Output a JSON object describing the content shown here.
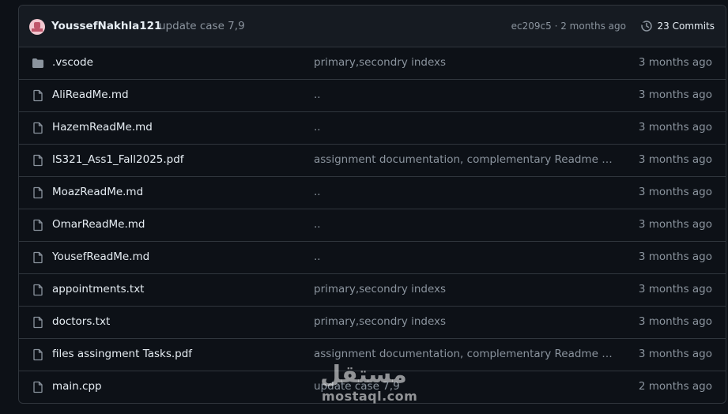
{
  "commit": {
    "author": "YoussefNakhla121",
    "message": "update case 7,9",
    "meta": "ec209c5 · 2 months ago",
    "commits_label": "23 Commits"
  },
  "files": [
    {
      "type": "folder",
      "name": ".vscode",
      "message": "primary,secondry indexs",
      "time": "3 months ago"
    },
    {
      "type": "file",
      "name": "AliReadMe.md",
      "message": "..",
      "time": "3 months ago"
    },
    {
      "type": "file",
      "name": "HazemReadMe.md",
      "message": "..",
      "time": "3 months ago"
    },
    {
      "type": "file",
      "name": "IS321_Ass1_Fall2025.pdf",
      "message": "assignment documentation, complementary Readme fil…",
      "time": "3 months ago"
    },
    {
      "type": "file",
      "name": "MoazReadMe.md",
      "message": "..",
      "time": "3 months ago"
    },
    {
      "type": "file",
      "name": "OmarReadMe.md",
      "message": "..",
      "time": "3 months ago"
    },
    {
      "type": "file",
      "name": "YousefReadMe.md",
      "message": "..",
      "time": "3 months ago"
    },
    {
      "type": "file",
      "name": "appointments.txt",
      "message": "primary,secondry indexs",
      "time": "3 months ago"
    },
    {
      "type": "file",
      "name": "doctors.txt",
      "message": "primary,secondry indexs",
      "time": "3 months ago"
    },
    {
      "type": "file",
      "name": "files assingment Tasks.pdf",
      "message": "assignment documentation, complementary Readme fil…",
      "time": "3 months ago"
    },
    {
      "type": "file",
      "name": "main.cpp",
      "message": "update case 7,9",
      "time": "2 months ago"
    }
  ],
  "watermark": {
    "text": "mostaql.com",
    "logo_text": "مستقل"
  },
  "colors": {
    "background": "#0d1117",
    "header_bg": "#161b22",
    "border": "#30363d",
    "text_primary": "#e6edf3",
    "text_muted": "#8b949e"
  }
}
